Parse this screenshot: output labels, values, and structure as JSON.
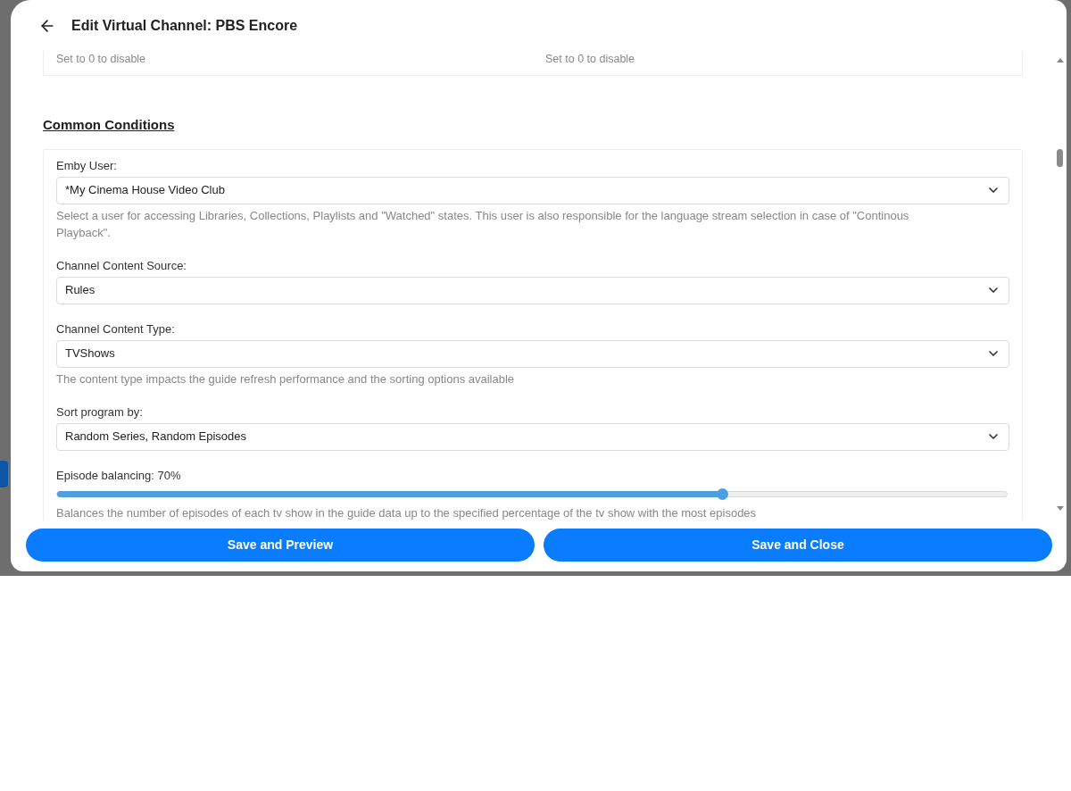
{
  "dialog": {
    "title": "Edit Virtual Channel: PBS Encore"
  },
  "top_hints": [
    "Set to 0 to disable",
    "Set to 0 to disable"
  ],
  "section": {
    "heading": "Common Conditions"
  },
  "fields": [
    {
      "kind": "select",
      "label": "Emby User:",
      "value": "*My Cinema House Video Club",
      "hint": "Select a user for accessing Libraries, Collections, Playlists and \"Watched\" states. This user is also responsible for the language stream selection in case of \"Continous Playback\"."
    },
    {
      "kind": "select",
      "label": "Channel Content Source:",
      "value": "Rules"
    },
    {
      "kind": "select",
      "label": "Channel Content Type:",
      "value": "TVShows",
      "hint": "The content type impacts the guide refresh performance and the sorting options available"
    },
    {
      "kind": "select",
      "label": "Sort program by:",
      "value": "Random Series, Random Episodes"
    },
    {
      "kind": "slider",
      "label": "Episode balancing: 70%",
      "level": 0.7,
      "hint": "Balances the number of episodes of each tv show in the guide data up to the specified percentage of the tv show with the most episodes"
    }
  ],
  "buttons": [
    "Save and Preview",
    "Save and Close"
  ]
}
